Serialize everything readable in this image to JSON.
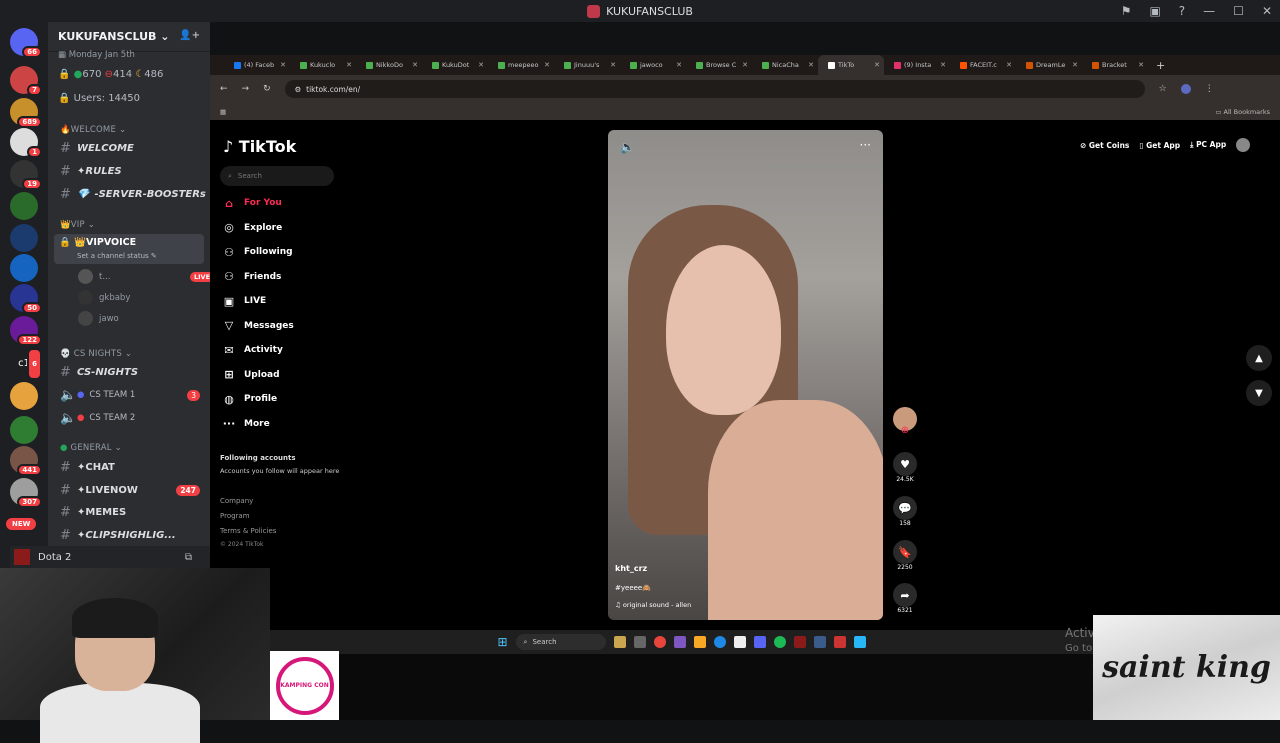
{
  "window": {
    "title": "KUKUFANSCLUB"
  },
  "guilds": {
    "badges": [
      "66",
      "7",
      "689",
      "1",
      "19",
      "50",
      "122",
      "6",
      "441",
      "307"
    ],
    "c1_label": "c1",
    "new_label": "NEW"
  },
  "server": {
    "name": "KUKUFANSCLUB",
    "event_line": "Monday Jan 5th",
    "stats": {
      "online": "670",
      "dnd": "414",
      "idle": "486"
    },
    "users": "Users: 14450",
    "categories": {
      "welcome": "WELCOME",
      "vip": "VIP",
      "cs_nights": "CS NIGHTS",
      "general": "GENERAL"
    },
    "channels": {
      "welcome": "WELCOME",
      "rules": "✦RULES",
      "boosters": "-SERVER-BOOSTERs",
      "vipvoice": "VIPVOICE",
      "vip_status": "Set a channel status",
      "cs_nights": "CS-NIGHTS",
      "cs_team1": "CS TEAM 1",
      "cs_team1_count": "3",
      "cs_team2": "CS TEAM 2",
      "chat": "✦CHAT",
      "livenow": "✦LIVENOW",
      "livenow_count": "247",
      "memes": "✦MEMES",
      "clips": "✦CLIPSHIGHLIG..."
    },
    "voice_users": [
      {
        "name": "t...",
        "badge": "LIVE"
      },
      {
        "name": "gkbaby"
      },
      {
        "name": "jawo"
      }
    ],
    "activity": "Dota 2"
  },
  "browser": {
    "tabs": [
      "(4) Faceb",
      "Kukuclo",
      "NikkoDo",
      "KukuDot",
      "meepeeo",
      "Jinuuu's",
      "jawoco",
      "Browse C",
      "NicaCha",
      "TikTo",
      "(9) Insta",
      "FACEIT.c",
      "DreamLe",
      "Bracket"
    ],
    "url": "tiktok.com/en/",
    "bookmarks": "All Bookmarks"
  },
  "tiktok": {
    "logo": "TikTok",
    "search_placeholder": "Search",
    "nav": [
      "For You",
      "Explore",
      "Following",
      "Friends",
      "LIVE",
      "Messages",
      "Activity",
      "Upload",
      "Profile",
      "More"
    ],
    "following_title": "Following accounts",
    "following_sub": "Accounts you follow will appear here",
    "footer": [
      "Company",
      "Program",
      "Terms & Policies",
      "© 2024 TikTok"
    ],
    "top_actions": [
      "Get Coins",
      "Get App",
      "PC App"
    ],
    "video": {
      "username": "kht_crz",
      "caption": "#yeeee🙈",
      "sound": "original sound - allen",
      "likes": "24.5K",
      "comments": "158",
      "saves": "2250",
      "shares": "6321"
    }
  },
  "taskbar": {
    "search": "Search"
  },
  "watermark": {
    "line1": "Activ",
    "line2": "Go to"
  },
  "overlays": {
    "kamping": "KAMPING CON",
    "saint_king": "saint king"
  }
}
